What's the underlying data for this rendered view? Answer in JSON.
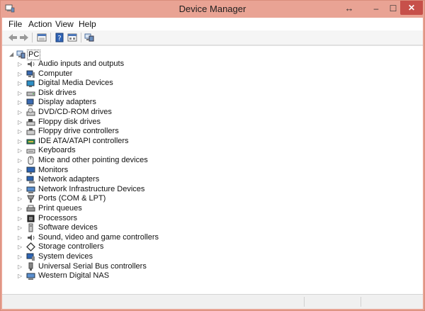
{
  "window": {
    "title": "Device Manager",
    "controls": {
      "resize": "↔",
      "minimize": "–",
      "maximize": "☐",
      "close": "✕"
    },
    "accent": "#e9a394",
    "close_color": "#c7504a"
  },
  "menu": {
    "items": [
      {
        "label": "File"
      },
      {
        "label": "Action"
      },
      {
        "label": "View"
      },
      {
        "label": "Help"
      }
    ]
  },
  "toolbar": {
    "buttons": [
      {
        "icon": "back-arrow-icon",
        "enabled": false
      },
      {
        "icon": "forward-arrow-icon",
        "enabled": false
      },
      {
        "icon": "properties-grid-icon"
      },
      {
        "icon": "help-book-icon"
      },
      {
        "icon": "view-list-icon"
      },
      {
        "icon": "computer-network-icon"
      }
    ]
  },
  "tree": {
    "root": {
      "label": "PC",
      "icon": "computer-icon",
      "expanded": true
    },
    "categories": [
      {
        "label": "Audio inputs and outputs",
        "icon": "speaker-icon"
      },
      {
        "label": "Computer",
        "icon": "computer-icon"
      },
      {
        "label": "Digital Media Devices",
        "icon": "media-device-icon"
      },
      {
        "label": "Disk drives",
        "icon": "disk-drive-icon"
      },
      {
        "label": "Display adapters",
        "icon": "display-adapter-icon"
      },
      {
        "label": "DVD/CD-ROM drives",
        "icon": "dvd-drive-icon"
      },
      {
        "label": "Floppy disk drives",
        "icon": "floppy-disk-icon"
      },
      {
        "label": "Floppy drive controllers",
        "icon": "floppy-controller-icon"
      },
      {
        "label": "IDE ATA/ATAPI controllers",
        "icon": "ide-controller-icon"
      },
      {
        "label": "Keyboards",
        "icon": "keyboard-icon"
      },
      {
        "label": "Mice and other pointing devices",
        "icon": "mouse-icon"
      },
      {
        "label": "Monitors",
        "icon": "monitor-icon"
      },
      {
        "label": "Network adapters",
        "icon": "network-adapter-icon"
      },
      {
        "label": "Network Infrastructure Devices",
        "icon": "network-infrastructure-icon"
      },
      {
        "label": "Ports (COM & LPT)",
        "icon": "port-icon"
      },
      {
        "label": "Print queues",
        "icon": "printer-icon"
      },
      {
        "label": "Processors",
        "icon": "processor-icon"
      },
      {
        "label": "Software devices",
        "icon": "software-device-icon"
      },
      {
        "label": "Sound, video and game controllers",
        "icon": "sound-icon"
      },
      {
        "label": "Storage controllers",
        "icon": "storage-controller-icon"
      },
      {
        "label": "System devices",
        "icon": "system-device-icon"
      },
      {
        "label": "Universal Serial Bus controllers",
        "icon": "usb-icon"
      },
      {
        "label": "Western Digital NAS",
        "icon": "nas-device-icon"
      }
    ]
  }
}
